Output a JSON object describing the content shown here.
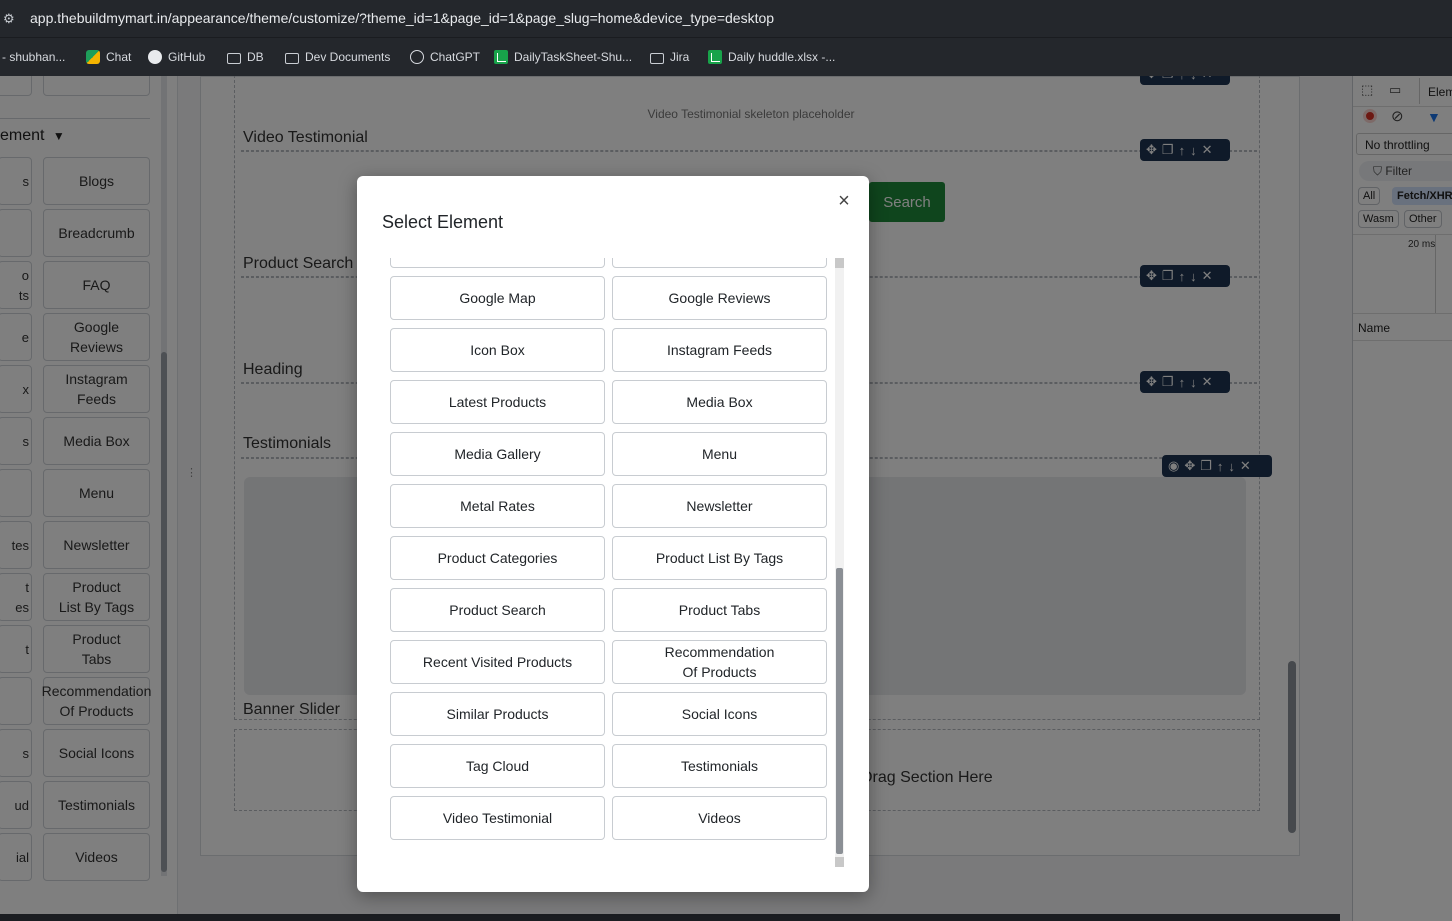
{
  "browser": {
    "url": "app.thebuildmymart.in/appearance/theme/customize/?theme_id=1&page_id=1&page_slug=home&device_type=desktop",
    "bookmarks": [
      {
        "label": "- shubhan...",
        "icon": "none"
      },
      {
        "label": "Chat",
        "icon": "chat-icon"
      },
      {
        "label": "GitHub",
        "icon": "github-icon"
      },
      {
        "label": "DB",
        "icon": "folder-icon"
      },
      {
        "label": "Dev Documents",
        "icon": "folder-icon"
      },
      {
        "label": "ChatGPT",
        "icon": "chatgpt-icon"
      },
      {
        "label": "DailyTaskSheet-Shu...",
        "icon": "sheets-icon"
      },
      {
        "label": "Jira",
        "icon": "folder-icon"
      },
      {
        "label": "Daily huddle.xlsx -...",
        "icon": "sheets-icon"
      }
    ]
  },
  "sidebar": {
    "group_label": "ement",
    "tiles_right": [
      "Blogs",
      "Breadcrumb",
      "FAQ",
      "Google\nReviews",
      "Instagram\nFeeds",
      "Media Box",
      "Menu",
      "Newsletter",
      "Product\nList By Tags",
      "Product\nTabs",
      "Recommendation\nOf Products",
      "Social Icons",
      "Testimonials",
      "Videos"
    ],
    "tiles_left": [
      "",
      "s",
      "",
      "o\nts",
      "e",
      "x",
      "s",
      "",
      "tes",
      "t\nes",
      "t",
      "",
      "s",
      "ud",
      "ial"
    ]
  },
  "canvas": {
    "video_placeholder": "Video Testimonial skeleton placeholder",
    "sections": [
      "Video Testimonial",
      "Product Search",
      "Heading",
      "Testimonials",
      "Banner Slider"
    ],
    "search_button": "Search",
    "drag_section": "Drag Section Here"
  },
  "devtools": {
    "tab": "Elem",
    "throttling": "No throttling",
    "filter": "Filter",
    "chips": [
      "All",
      "Fetch/XHR",
      "Wasm",
      "Other"
    ],
    "timeline_label": "20 ms",
    "name_header": "Name"
  },
  "modal": {
    "title": "Select Element",
    "close": "×",
    "elements": [
      "Google Map",
      "Google Reviews",
      "Icon Box",
      "Instagram Feeds",
      "Latest Products",
      "Media Box",
      "Media Gallery",
      "Menu",
      "Metal Rates",
      "Newsletter",
      "Product Categories",
      "Product List By Tags",
      "Product Search",
      "Product Tabs",
      "Recent Visited Products",
      "Recommendation\nOf Products",
      "Similar Products",
      "Social Icons",
      "Tag Cloud",
      "Testimonials",
      "Video Testimonial",
      "Videos"
    ]
  }
}
